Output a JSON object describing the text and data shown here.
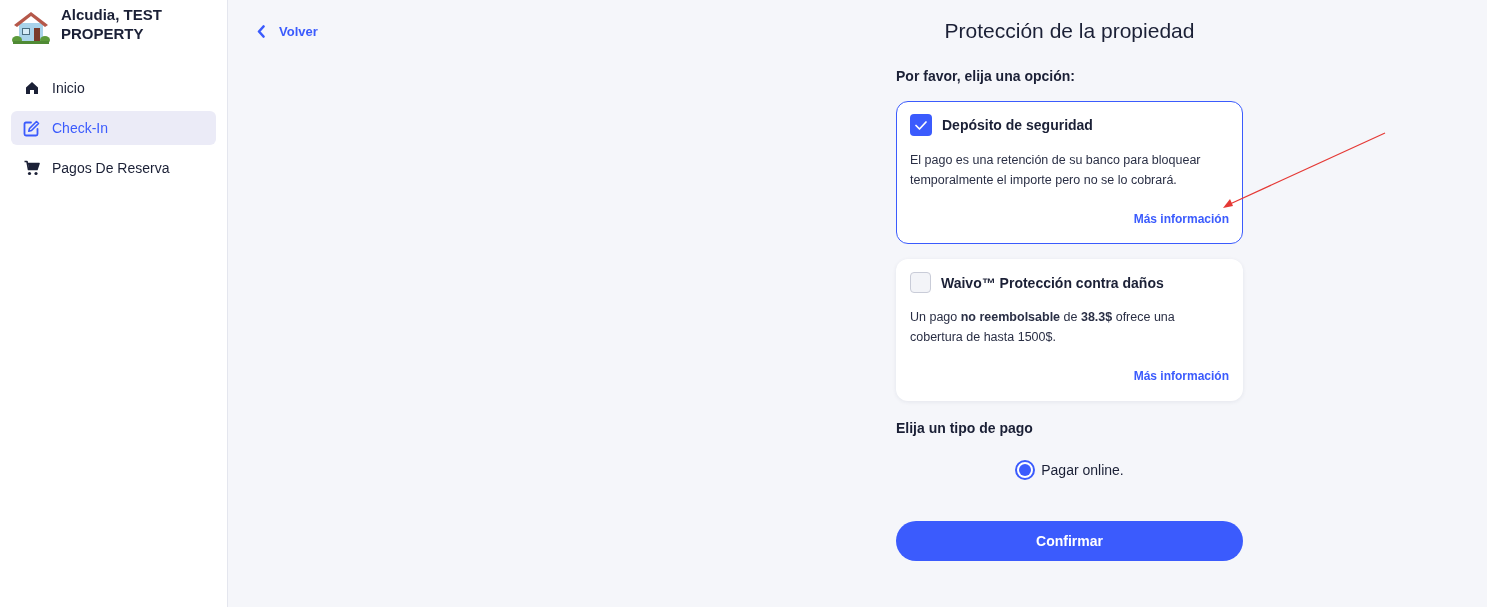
{
  "sidebar": {
    "property_name": "Alcudia, TEST PROPERTY",
    "items": [
      {
        "label": "Inicio",
        "selected": false
      },
      {
        "label": "Check-In",
        "selected": true
      },
      {
        "label": "Pagos De Reserva",
        "selected": false
      }
    ]
  },
  "back_link": {
    "label": "Volver"
  },
  "page_title": "Protección de la propiedad",
  "options_prompt": "Por favor, elija una opción:",
  "options": [
    {
      "title": "Depósito de seguridad",
      "checked": true,
      "description": "El pago es una retención de su banco para bloquear temporalmente el importe pero no se lo cobrará.",
      "link": "Más información"
    },
    {
      "title": "Waivo™ Protección contra daños",
      "checked": false,
      "description": "Un pago **no reembolsable** de **38.3$** ofrece una cobertura de hasta 1500$.",
      "link": "Más información"
    }
  ],
  "payment_type": {
    "heading": "Elija un tipo de pago",
    "choices": [
      {
        "label": "Pagar online.",
        "selected": true
      }
    ]
  },
  "confirm_button": {
    "label": "Confirmar"
  }
}
